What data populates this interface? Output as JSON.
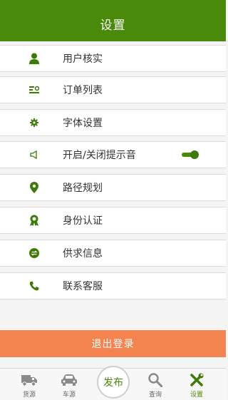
{
  "header": {
    "title": "设置"
  },
  "menu": [
    {
      "label": "用户核实",
      "icon": "user-icon"
    },
    {
      "label": "订单列表",
      "icon": "order-list-icon"
    },
    {
      "label": "字体设置",
      "icon": "gear-icon"
    },
    {
      "label": "开启/关闭提示音",
      "icon": "speaker-icon",
      "toggle_on": true
    },
    {
      "label": "路径规划",
      "icon": "location-pin-icon"
    },
    {
      "label": "身份认证",
      "icon": "badge-icon"
    },
    {
      "label": "供求信息",
      "icon": "exchange-icon"
    },
    {
      "label": "联系客服",
      "icon": "phone-icon"
    }
  ],
  "logout_label": "退出登录",
  "tabs": [
    {
      "label": "货源",
      "icon": "truck-icon",
      "active": false
    },
    {
      "label": "车源",
      "icon": "car-icon",
      "active": false
    },
    {
      "label": "发布",
      "icon": "publish-button",
      "active": false
    },
    {
      "label": "查询",
      "icon": "search-icon",
      "active": false
    },
    {
      "label": "设置",
      "icon": "tools-icon",
      "active": true
    }
  ],
  "colors": {
    "primary_green": "#4a8a0b",
    "logout_orange": "#f3844f",
    "background": "#f4f4f4"
  }
}
